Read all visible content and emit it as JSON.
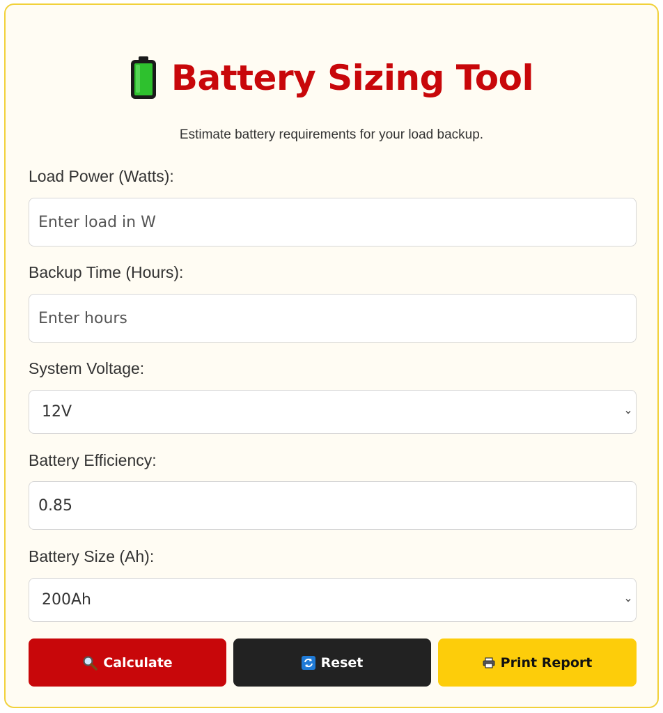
{
  "header": {
    "icon": "battery-icon",
    "title": "Battery Sizing Tool",
    "subtitle": "Estimate battery requirements for your load backup."
  },
  "form": {
    "load_power": {
      "label": "Load Power (Watts):",
      "placeholder": "Enter load in W",
      "value": ""
    },
    "backup_time": {
      "label": "Backup Time (Hours):",
      "placeholder": "Enter hours",
      "value": ""
    },
    "system_voltage": {
      "label": "System Voltage:",
      "selected": "12V"
    },
    "efficiency": {
      "label": "Battery Efficiency:",
      "value": "0.85"
    },
    "battery_size": {
      "label": "Battery Size (Ah):",
      "selected": "200Ah"
    }
  },
  "buttons": {
    "calculate": {
      "label": "Calculate",
      "icon": "magnifier-icon",
      "color": "#c8070a"
    },
    "reset": {
      "label": "Reset",
      "icon": "refresh-icon",
      "color": "#222222"
    },
    "print": {
      "label": "Print Report",
      "icon": "printer-icon",
      "color": "#fdcd0a"
    }
  },
  "colors": {
    "accent": "#c8070a",
    "border": "#f1d13a",
    "background": "#fffcf3"
  }
}
